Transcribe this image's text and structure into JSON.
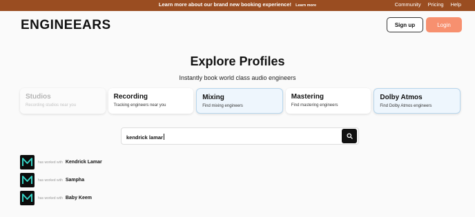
{
  "announcement": {
    "message": "Learn more about our brand new booking experience!",
    "learn_more": "Learn more",
    "links": [
      "Community",
      "Pricing",
      "Help"
    ]
  },
  "header": {
    "logo": "ENGINEEARS",
    "signup_label": "Sign up",
    "login_label": "Login",
    "colors": {
      "accent": "#f7906f",
      "announcement_bg": "#9a4d21"
    }
  },
  "hero": {
    "title": "Explore Profiles",
    "subtitle": "Instantly book world class audio engineers"
  },
  "categories": [
    {
      "title": "Studios",
      "description": "Recording studios near you",
      "state": "disabled"
    },
    {
      "title": "Recording",
      "description": "Tracking engineers near you",
      "state": "default"
    },
    {
      "title": "Mixing",
      "description": "Find mixing engineers",
      "state": "selected"
    },
    {
      "title": "Mastering",
      "description": "Find mastering engineers",
      "state": "default"
    },
    {
      "title": "Dolby Atmos",
      "description": "Find Dolby Atmos engineers",
      "state": "selected"
    }
  ],
  "search": {
    "value": "kendrick lamar",
    "button_icon": "search-icon"
  },
  "results": [
    {
      "prefix": "has worked with",
      "name": "Kendrick Lamar",
      "icon": "m-logo-icon"
    },
    {
      "prefix": "has worked with",
      "name": "Sampha",
      "icon": "m-logo-icon"
    },
    {
      "prefix": "has worked with",
      "name": "Baby Keem",
      "icon": "m-logo-icon"
    }
  ]
}
